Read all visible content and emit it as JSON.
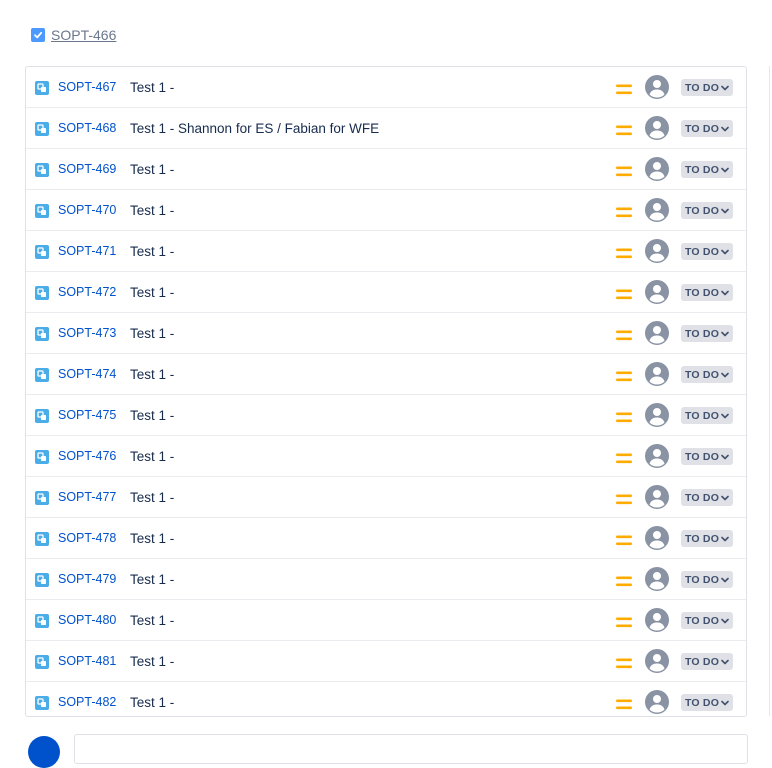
{
  "parent": {
    "key": "SOPT-466"
  },
  "colors": {
    "link": "#0052cc",
    "subtask_icon": "#4bade8",
    "priority_medium": "#ffab00",
    "avatar": "#8993a4",
    "status_bg": "#dfe1e6",
    "status_text": "#42526e"
  },
  "icons": {
    "parent": "checkbox-icon",
    "issue_type": "subtask-icon",
    "priority": "priority-medium-icon",
    "assignee": "unassigned-avatar-icon",
    "status_dropdown": "chevron-down-icon"
  },
  "subtasks": [
    {
      "key": "SOPT-467",
      "summary": "Test 1 -",
      "status": "TO DO"
    },
    {
      "key": "SOPT-468",
      "summary": "Test 1 - Shannon for ES / Fabian for WFE",
      "status": "TO DO"
    },
    {
      "key": "SOPT-469",
      "summary": "Test 1 -",
      "status": "TO DO"
    },
    {
      "key": "SOPT-470",
      "summary": "Test 1 -",
      "status": "TO DO"
    },
    {
      "key": "SOPT-471",
      "summary": "Test 1 -",
      "status": "TO DO"
    },
    {
      "key": "SOPT-472",
      "summary": "Test 1 -",
      "status": "TO DO"
    },
    {
      "key": "SOPT-473",
      "summary": "Test 1 -",
      "status": "TO DO"
    },
    {
      "key": "SOPT-474",
      "summary": "Test 1 -",
      "status": "TO DO"
    },
    {
      "key": "SOPT-475",
      "summary": "Test 1 -",
      "status": "TO DO"
    },
    {
      "key": "SOPT-476",
      "summary": "Test 1 -",
      "status": "TO DO"
    },
    {
      "key": "SOPT-477",
      "summary": "Test 1 -",
      "status": "TO DO"
    },
    {
      "key": "SOPT-478",
      "summary": "Test 1 -",
      "status": "TO DO"
    },
    {
      "key": "SOPT-479",
      "summary": "Test 1 -",
      "status": "TO DO"
    },
    {
      "key": "SOPT-480",
      "summary": "Test 1 -",
      "status": "TO DO"
    },
    {
      "key": "SOPT-481",
      "summary": "Test 1 -",
      "status": "TO DO"
    },
    {
      "key": "SOPT-482",
      "summary": "Test 1 -",
      "status": "TO DO"
    }
  ]
}
